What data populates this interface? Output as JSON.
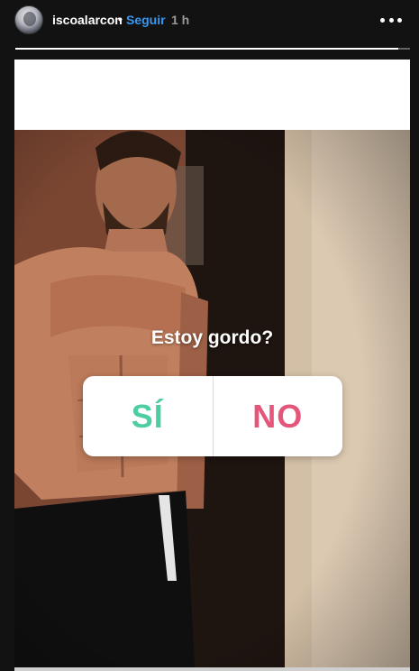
{
  "header": {
    "username": "iscoalarcon",
    "separator": "•",
    "follow_label": "Seguir",
    "time": "1 h",
    "more_icon": "more-horizontal-icon",
    "avatar_icon": "profile-avatar"
  },
  "story": {
    "progress": 0.97,
    "question": "Estoy gordo?",
    "poll": {
      "options": [
        {
          "label": "SÍ",
          "color": "#4ecda2"
        },
        {
          "label": "NO",
          "color": "#e4577a"
        }
      ]
    }
  },
  "colors": {
    "background": "#121212",
    "follow_accent": "#3897f0",
    "time_gray": "#999999"
  }
}
